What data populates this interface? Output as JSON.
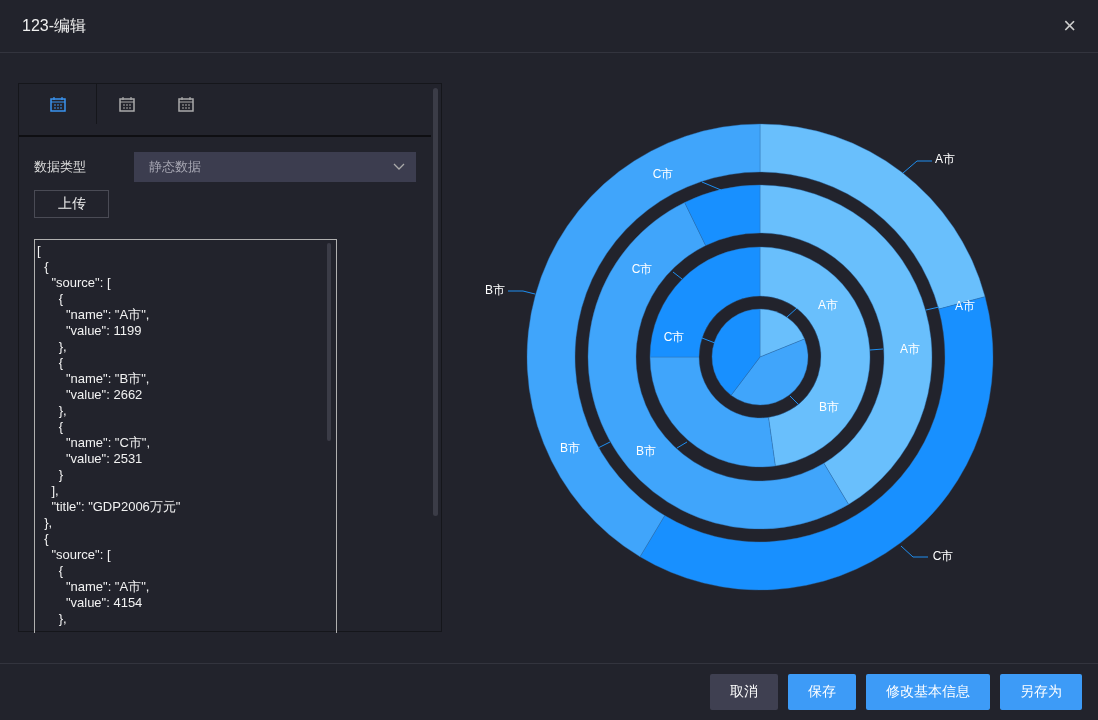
{
  "window": {
    "title": "123-编辑",
    "close": "×"
  },
  "tabs": [
    {
      "selected": true
    },
    {
      "selected": false
    },
    {
      "selected": false
    }
  ],
  "data_type": {
    "label": "数据类型",
    "value": "静态数据"
  },
  "upload_button": "上传",
  "code_lines": [
    "[",
    "  {",
    "    \"source\": [",
    "      {",
    "        \"name\": \"A市\",",
    "        \"value\": 1199",
    "      },",
    "      {",
    "        \"name\": \"B市\",",
    "        \"value\": 2662",
    "      },",
    "      {",
    "        \"name\": \"C市\",",
    "        \"value\": 2531",
    "      }",
    "    ],",
    "    \"title\": \"GDP2006万元\"",
    "  },",
    "  {",
    "    \"source\": [",
    "      {",
    "        \"name\": \"A市\",",
    "        \"value\": 4154",
    "      },"
  ],
  "chart": {
    "rings": [
      {
        "slices": [
          {
            "label": "A市",
            "color": "#69bffc"
          },
          {
            "label": "B市",
            "color": "#40a5fb"
          },
          {
            "label": "C市",
            "color": "#1890ff"
          }
        ]
      },
      {
        "slices": [
          {
            "label": "A市",
            "color": "#69bffc"
          },
          {
            "label": "B市",
            "color": "#40a5fb"
          },
          {
            "label": "C市",
            "color": "#1890ff"
          }
        ]
      },
      {
        "slices": [
          {
            "label": "A市",
            "color": "#69bffc"
          },
          {
            "label": "B市",
            "color": "#40a5fb"
          },
          {
            "label": "C市",
            "color": "#1890ff"
          }
        ]
      },
      {
        "slices": [
          {
            "label": "A市",
            "color": "#69bffc"
          },
          {
            "label": "C市",
            "color": "#1890ff"
          },
          {
            "label": "B市",
            "color": "#40a5fb"
          }
        ]
      }
    ]
  },
  "buttons": [
    {
      "label": "取消",
      "kind": "secondary"
    },
    {
      "label": "保存",
      "kind": "primary"
    },
    {
      "label": "修改基本信息",
      "kind": "primary"
    },
    {
      "label": "另存为",
      "kind": "primary"
    }
  ]
}
